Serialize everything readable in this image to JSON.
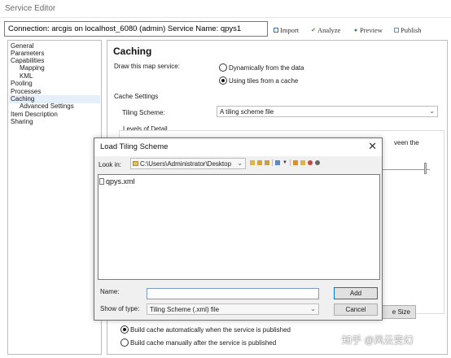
{
  "window": {
    "title": "Service Editor"
  },
  "header": {
    "connection": "Connection: arcgis on localhost_6080 (admin)   Service Name: qpys1"
  },
  "toolbar": {
    "import": "Import",
    "analyze": "Analyze",
    "preview": "Preview",
    "publish": "Publish"
  },
  "sidebar": {
    "items": [
      "General",
      "Parameters",
      "Capabilities",
      "Mapping",
      "KML",
      "Pooling",
      "Processes",
      "Caching",
      "Advanced Settings",
      "Item Description",
      "Sharing"
    ]
  },
  "caching": {
    "heading": "Caching",
    "draw_label": "Draw this map service:",
    "opt_dynamic": "Dynamically from the data",
    "opt_tiles": "Using tiles from a cache",
    "cache_settings": "Cache Settings",
    "scheme_label": "Tiling Scheme:",
    "scheme_value": "A tiling scheme file",
    "lod_label": "Levels of Detail",
    "partial_right_text": "veen the",
    "partial_size_button": "e Size",
    "build_auto": "Build cache automatically when the service is published",
    "build_manual": "Build cache manually after the service is published"
  },
  "dialog": {
    "title": "Load Tiling Scheme",
    "look_in_label": "Look in:",
    "look_in_value": "C:\\Users\\Administrator\\Desktop",
    "files": [
      "qpys.xml"
    ],
    "name_label": "Name:",
    "name_value": "",
    "type_label": "Show of type:",
    "type_value": "Tiling Scheme (.xml) file",
    "add_button": "Add",
    "cancel_button": "Cancel"
  },
  "watermark": "知乎 @风云变幻",
  "colors": {
    "selection": "#e5eefb",
    "focus": "#0078d7"
  }
}
